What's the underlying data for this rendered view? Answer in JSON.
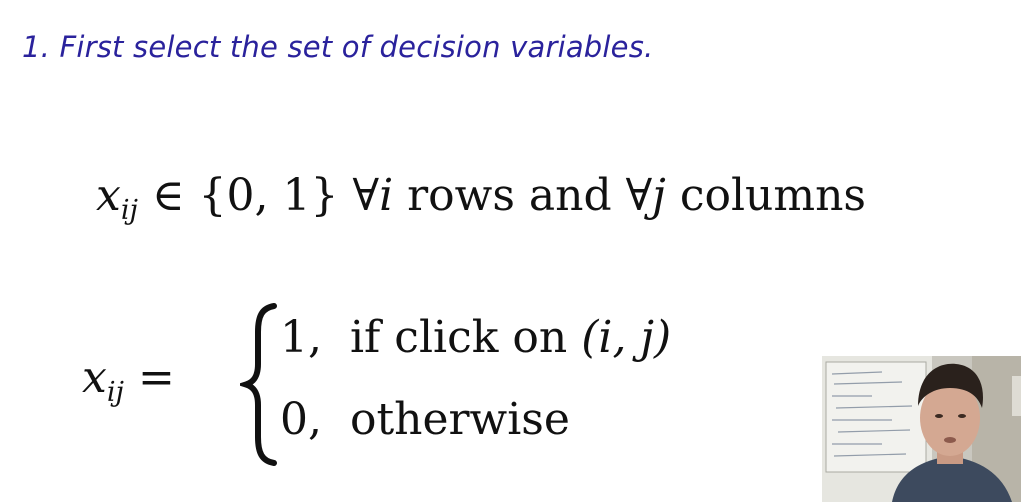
{
  "heading": "1. First select the set of decision variables.",
  "line1": {
    "var": "x",
    "sub": "ij",
    "in": " ∈ {0, 1} ",
    "forall_i": "∀",
    "i": "i",
    "rows": " rows and ",
    "forall_j": "∀",
    "j": "j",
    "columns": " columns"
  },
  "line2": {
    "var": "x",
    "sub": "ij",
    "eq": " ="
  },
  "cases": {
    "case1_num": "1,",
    "case1_text": "  if click on ",
    "case1_args": "(i, j)",
    "case2_num": "0,",
    "case2_text": "  otherwise"
  },
  "colors": {
    "heading": "#2a229c",
    "math": "#111111"
  }
}
